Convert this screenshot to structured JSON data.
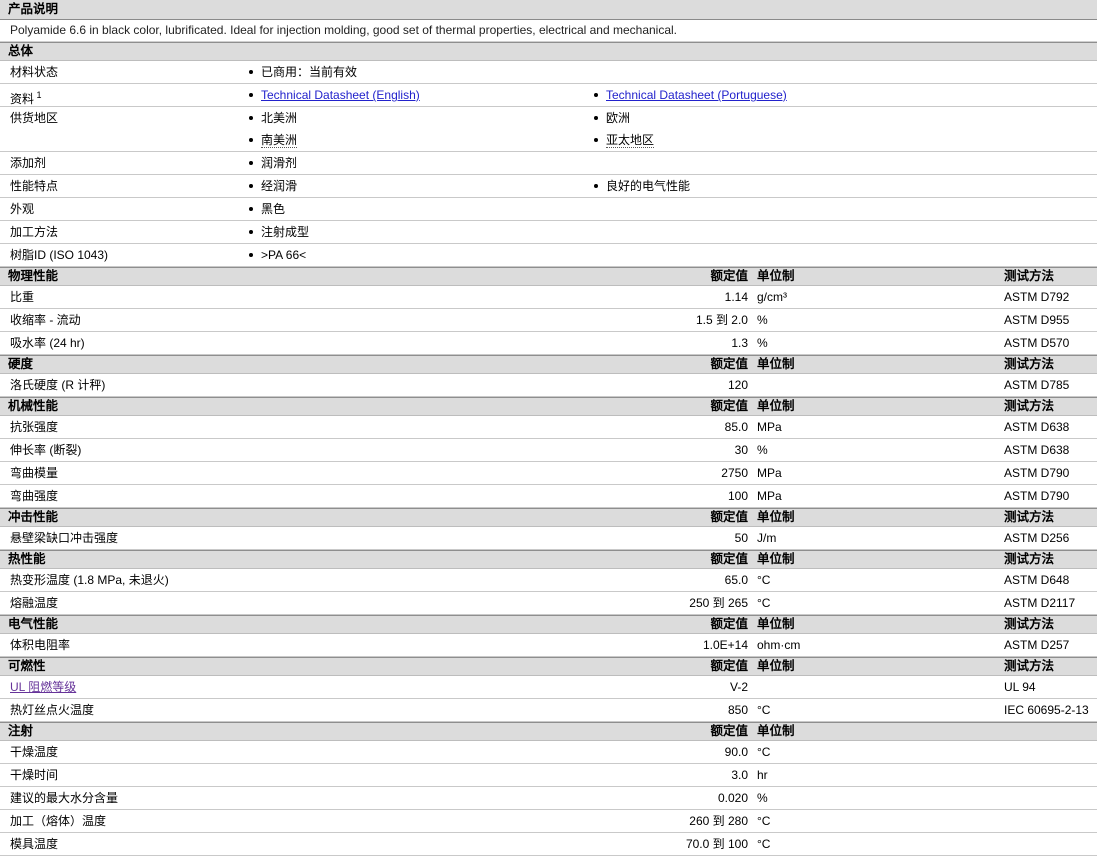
{
  "header": {
    "title": "产品说明",
    "description": "Polyamide 6.6 in black color, lubrificated. Ideal for injection molding, good set of thermal properties, electrical and mechanical."
  },
  "columns": {
    "value_label": "额定值",
    "unit_label": "单位制",
    "test_label": "测试方法"
  },
  "colors": {
    "link_blue": "#2222cc",
    "link_purple": "#663399",
    "bar_gray": "#dcdcdc"
  },
  "general": {
    "title": "总体",
    "rows": [
      {
        "label": "材料状态",
        "sup": "",
        "col1": [
          {
            "text": "已商用：当前有效"
          }
        ],
        "col2": []
      },
      {
        "label": "资料",
        "sup": "1",
        "col1": [
          {
            "text": "Technical Datasheet (English)",
            "link": true
          }
        ],
        "col2": [
          {
            "text": "Technical Datasheet (Portuguese)",
            "link": true
          }
        ]
      },
      {
        "label": "供货地区",
        "sup": "",
        "col1": [
          {
            "text": "北美洲"
          },
          {
            "text": "南美洲",
            "dotted": true
          }
        ],
        "col2": [
          {
            "text": "欧洲"
          },
          {
            "text": "亚太地区",
            "dotted": true
          }
        ]
      },
      {
        "label": "添加剂",
        "sup": "",
        "col1": [
          {
            "text": "润滑剂"
          }
        ],
        "col2": []
      },
      {
        "label": "性能特点",
        "sup": "",
        "col1": [
          {
            "text": "经润滑"
          }
        ],
        "col2": [
          {
            "text": "良好的电气性能"
          }
        ]
      },
      {
        "label": "外观",
        "sup": "",
        "col1": [
          {
            "text": "黑色"
          }
        ],
        "col2": []
      },
      {
        "label": "加工方法",
        "sup": "",
        "col1": [
          {
            "text": "注射成型"
          }
        ],
        "col2": []
      },
      {
        "label": "树脂ID (ISO 1043)",
        "sup": "",
        "col1": [
          {
            "text": ">PA 66<"
          }
        ],
        "col2": []
      }
    ]
  },
  "property_sections": [
    {
      "title": "物理性能",
      "has_test": true,
      "rows": [
        {
          "label": "比重",
          "value": "1.14",
          "unit": "g/cm³",
          "test": "ASTM D792"
        },
        {
          "label": "收缩率 - 流动",
          "value": "1.5 到 2.0",
          "unit": "%",
          "test": "ASTM D955"
        },
        {
          "label": "吸水率 (24 hr)",
          "value": "1.3",
          "unit": "%",
          "test": "ASTM D570"
        }
      ]
    },
    {
      "title": "硬度",
      "has_test": true,
      "rows": [
        {
          "label": "洛氏硬度 (R 计秤)",
          "value": "120",
          "unit": "",
          "test": "ASTM D785"
        }
      ]
    },
    {
      "title": "机械性能",
      "has_test": true,
      "rows": [
        {
          "label": "抗张强度",
          "value": "85.0",
          "unit": "MPa",
          "test": "ASTM D638"
        },
        {
          "label": "伸长率 (断裂)",
          "value": "30",
          "unit": "%",
          "test": "ASTM D638"
        },
        {
          "label": "弯曲模量",
          "value": "2750",
          "unit": "MPa",
          "test": "ASTM D790"
        },
        {
          "label": "弯曲强度",
          "value": "100",
          "unit": "MPa",
          "test": "ASTM D790"
        }
      ]
    },
    {
      "title": "冲击性能",
      "has_test": true,
      "rows": [
        {
          "label": "悬壁梁缺口冲击强度",
          "value": "50",
          "unit": "J/m",
          "test": "ASTM D256"
        }
      ]
    },
    {
      "title": "热性能",
      "has_test": true,
      "rows": [
        {
          "label": "热变形温度 (1.8 MPa, 未退火)",
          "value": "65.0",
          "unit": "°C",
          "test": "ASTM D648"
        },
        {
          "label": "熔融温度",
          "value": "250 到 265",
          "unit": "°C",
          "test": "ASTM D2117"
        }
      ]
    },
    {
      "title": "电气性能",
      "has_test": true,
      "rows": [
        {
          "label": "体积电阻率",
          "value": "1.0E+14",
          "unit": "ohm·cm",
          "test": "ASTM D257"
        }
      ]
    },
    {
      "title": "可燃性",
      "has_test": true,
      "rows": [
        {
          "label": "UL 阻燃等级",
          "label_link": true,
          "value": "V-2",
          "unit": "",
          "test": "UL 94"
        },
        {
          "label": "热灯丝点火温度",
          "value": "850",
          "unit": "°C",
          "test": "IEC 60695-2-13"
        }
      ]
    },
    {
      "title": "注射",
      "has_test": false,
      "rows": [
        {
          "label": "干燥温度",
          "value": "90.0",
          "unit": "°C",
          "test": ""
        },
        {
          "label": "干燥时间",
          "value": "3.0",
          "unit": "hr",
          "test": ""
        },
        {
          "label": "建议的最大水分含量",
          "value": "0.020",
          "unit": "%",
          "test": ""
        },
        {
          "label": "加工（熔体）温度",
          "value": "260 到 280",
          "unit": "°C",
          "test": ""
        },
        {
          "label": "模具温度",
          "value": "70.0 到 100",
          "unit": "°C",
          "test": ""
        }
      ]
    }
  ]
}
